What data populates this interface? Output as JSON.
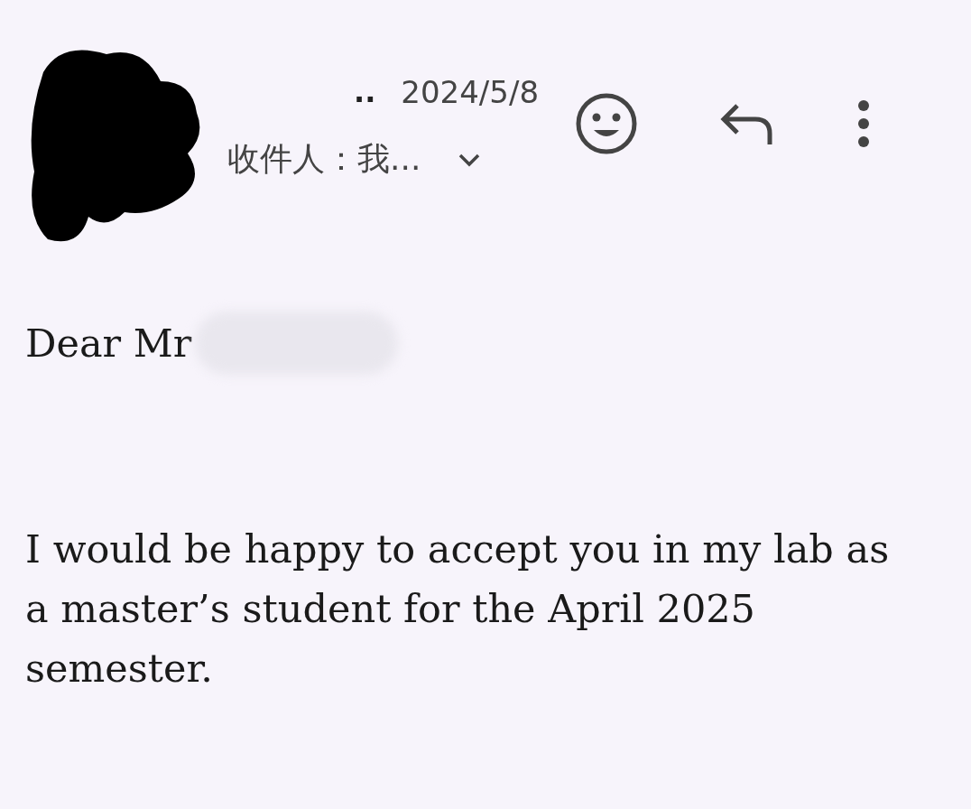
{
  "header": {
    "sender": "..",
    "date": "2024/5/8",
    "recipient": "收件人：我..."
  },
  "body": {
    "greeting": "Dear Mr",
    "paragraphs": [
      "I would be happy to accept you in my lab as a master’s student for the April 2025 semester."
    ]
  }
}
